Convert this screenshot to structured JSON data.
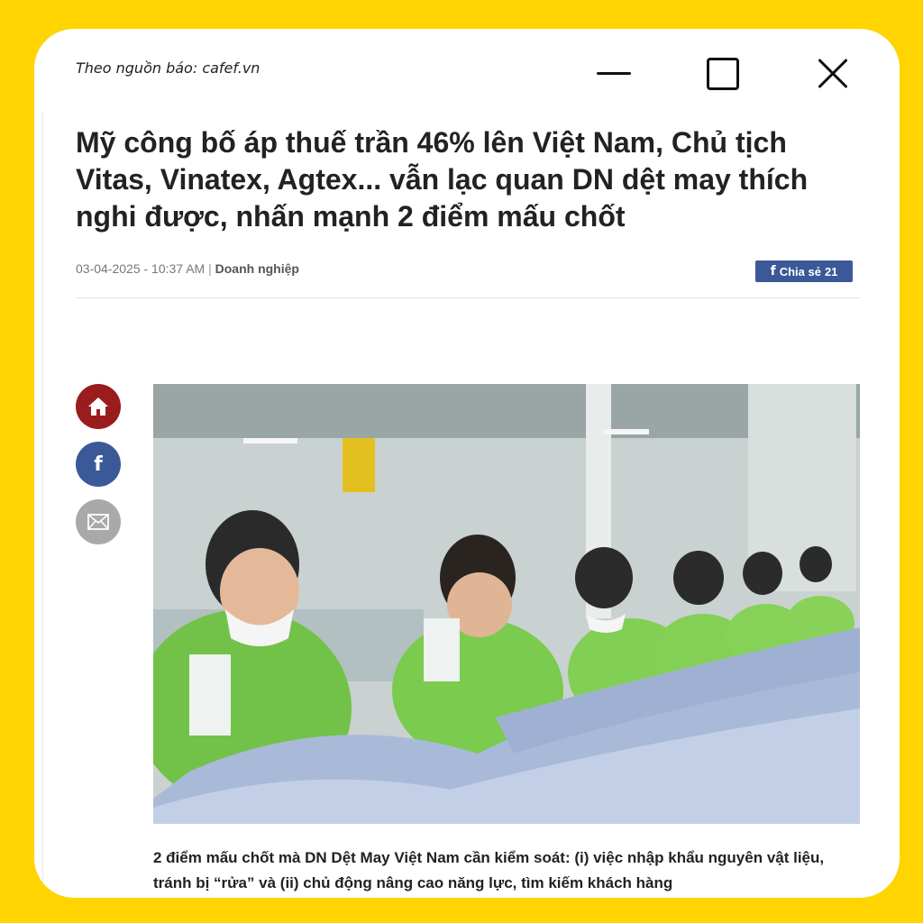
{
  "source": "Theo nguồn báo: cafef.vn",
  "window_controls": [
    "minimize",
    "maximize",
    "close"
  ],
  "article": {
    "headline": "Mỹ công bố áp thuế trần 46% lên Việt Nam, Chủ tịch Vitas, Vinatex, Agtex... vẫn lạc quan DN dệt may thích nghi được, nhấn mạnh 2 điểm mấu chốt",
    "date": "03-04-2025 - 10:37 AM",
    "separator": "|",
    "category": "Doanh nghiệp",
    "share_label": "Chia sẻ",
    "share_count": "21",
    "lede": "2 điểm mấu chốt mà DN Dệt May Việt Nam cần kiểm soát: (i) việc nhập khẩu nguyên vật liệu, tránh bị “rửa” và (ii) chủ động nâng cao năng lực, tìm kiếm khách hàng"
  },
  "social_icons": [
    "home-icon",
    "facebook-icon",
    "mail-icon"
  ],
  "colors": {
    "background": "#FFD400",
    "facebook": "#3b5998",
    "home": "#9b1c1c",
    "mail": "#a9a9a9"
  }
}
